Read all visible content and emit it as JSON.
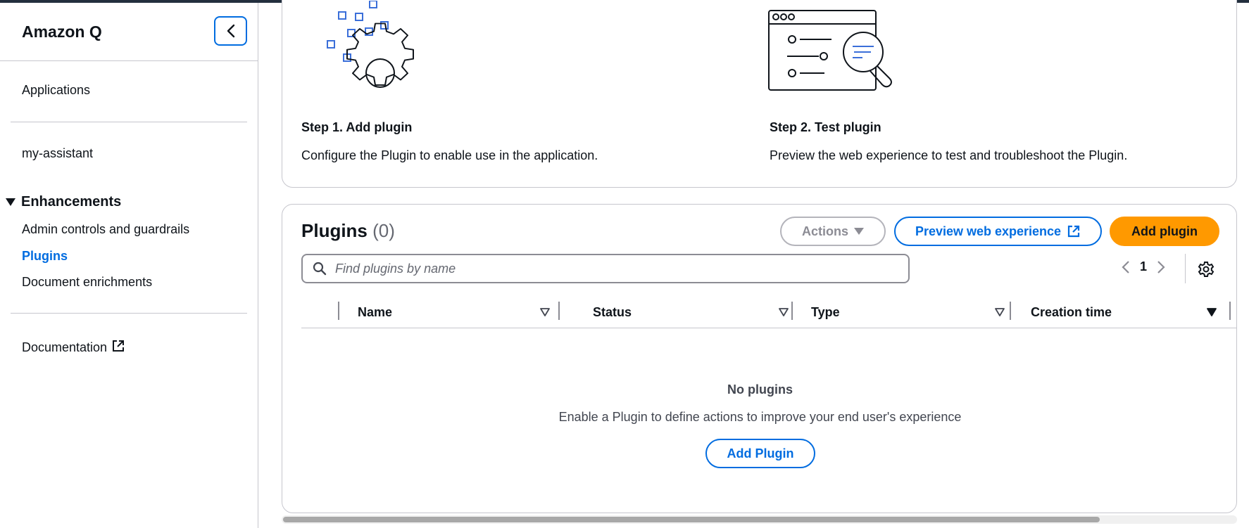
{
  "sidebar": {
    "title": "Amazon Q",
    "applications": "Applications",
    "app_name": "my-assistant",
    "section": "Enhancements",
    "items": [
      {
        "label": "Admin controls and guardrails"
      },
      {
        "label": "Plugins"
      },
      {
        "label": "Document enrichments"
      }
    ],
    "documentation": "Documentation"
  },
  "steps": [
    {
      "title": "Step 1. Add plugin",
      "description": "Configure the Plugin to enable use in the application.",
      "icon": "gear-icon"
    },
    {
      "title": "Step 2. Test plugin",
      "description": "Preview the web experience to test and troubleshoot the Plugin.",
      "icon": "magnifier-window-icon"
    }
  ],
  "plugins": {
    "title": "Plugins",
    "count": "(0)",
    "actions_label": "Actions",
    "preview_label": "Preview web experience",
    "add_label": "Add plugin",
    "search_placeholder": "Find plugins by name",
    "page": "1",
    "columns": [
      "Name",
      "Status",
      "Type",
      "Creation time"
    ],
    "empty_title": "No plugins",
    "empty_desc": "Enable a Plugin to define actions to improve your end user's experience",
    "empty_button": "Add Plugin"
  },
  "colors": {
    "accent": "#006ce0",
    "primary_button": "#ff9900",
    "topbar": "#232f3e"
  }
}
